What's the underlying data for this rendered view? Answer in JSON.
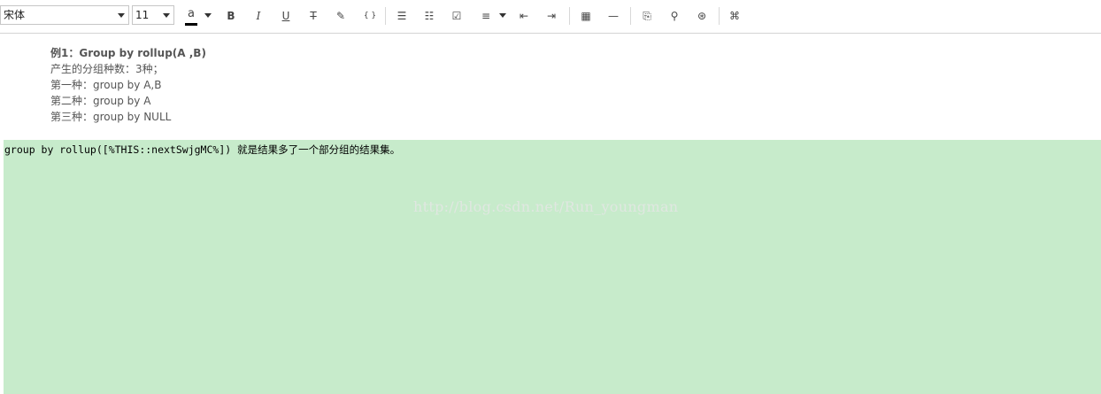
{
  "toolbar": {
    "font_name": "宋体",
    "font_size": "11",
    "font_color_label": "a",
    "bold": "B",
    "italic": "I",
    "underline": "U",
    "strikethrough": "T",
    "highlighter_glyph": "✎",
    "code_glyph": "{ }",
    "bullet_list_glyph": "☰",
    "numbered_list_glyph": "☷",
    "checkbox_glyph": "☑",
    "align_glyph": "≡",
    "outdent_glyph": "⇤",
    "indent_glyph": "⇥",
    "table_glyph": "▦",
    "hr_glyph": "—",
    "attach_glyph": "⎘",
    "link_glyph": "⚲",
    "emoji_glyph": "⊛",
    "command_glyph": "⌘"
  },
  "notes": {
    "title": "例1：Group by rollup(A ,B)",
    "lines": [
      "产生的分组种数：3种；",
      "第一种：group by A,B",
      "第二种：group by A",
      "第三种：group by NULL"
    ]
  },
  "code": {
    "line": "group by rollup([%THIS::nextSwjgMC%]) 就是结果多了一个部分组的结果集。",
    "background": "#c7ebcb"
  },
  "watermark": "http://blog.csdn.net/Run_youngman"
}
